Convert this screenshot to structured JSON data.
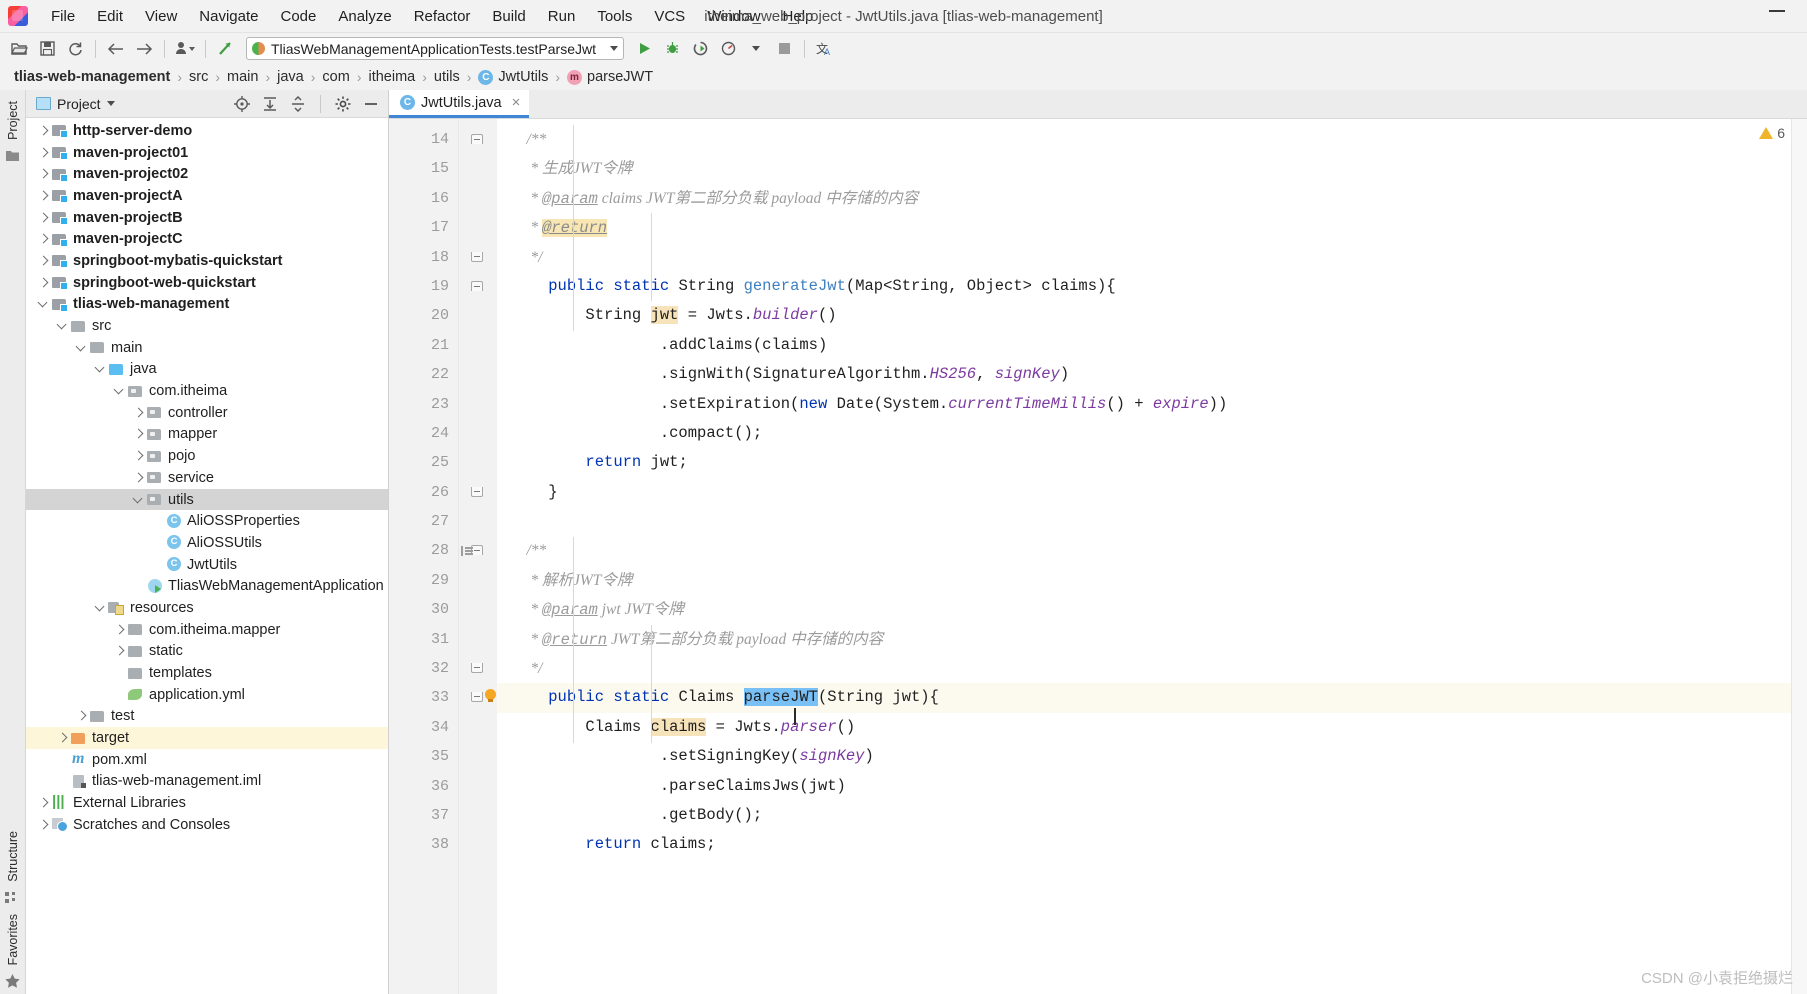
{
  "window": {
    "title": "itheima_web_project - JwtUtils.java [tlias-web-management]",
    "minimize_label": "—"
  },
  "menubar": {
    "items": [
      {
        "label": "File",
        "mnemonic": "F"
      },
      {
        "label": "Edit",
        "mnemonic": "E"
      },
      {
        "label": "View",
        "mnemonic": "V"
      },
      {
        "label": "Navigate",
        "mnemonic": "N"
      },
      {
        "label": "Code",
        "mnemonic": "C"
      },
      {
        "label": "Analyze",
        "mnemonic": "z"
      },
      {
        "label": "Refactor",
        "mnemonic": "R"
      },
      {
        "label": "Build",
        "mnemonic": "B"
      },
      {
        "label": "Run",
        "mnemonic": "u"
      },
      {
        "label": "Tools",
        "mnemonic": "T"
      },
      {
        "label": "VCS",
        "mnemonic": "S"
      },
      {
        "label": "Window",
        "mnemonic": "W"
      },
      {
        "label": "Help",
        "mnemonic": "H"
      }
    ]
  },
  "toolbar": {
    "run_config": "TliasWebManagementApplicationTests.testParseJwt",
    "buttons": [
      "open-project-icon",
      "save-all-icon",
      "sync-icon",
      "back-icon",
      "forward-icon",
      "profile-icon",
      "update-project-icon",
      "run-icon",
      "debug-icon",
      "run-coverage-icon",
      "profiler-icon",
      "stop-icon",
      "translate-icon"
    ]
  },
  "breadcrumb": {
    "items": [
      {
        "label": "tlias-web-management",
        "icon": "",
        "bold": true
      },
      {
        "label": "src",
        "icon": ""
      },
      {
        "label": "main",
        "icon": ""
      },
      {
        "label": "java",
        "icon": ""
      },
      {
        "label": "com",
        "icon": ""
      },
      {
        "label": "itheima",
        "icon": ""
      },
      {
        "label": "utils",
        "icon": ""
      },
      {
        "label": "JwtUtils",
        "icon": "class"
      },
      {
        "label": "parseJWT",
        "icon": "method"
      }
    ],
    "separator": "›"
  },
  "left_rail": {
    "top_label": "Project",
    "structure_label": "Structure",
    "favorites_label": "Favorites"
  },
  "project_panel": {
    "title": "Project",
    "header_buttons": [
      "locate-icon",
      "expand-all-icon",
      "collapse-all-icon",
      "gear-icon",
      "hide-icon"
    ],
    "tree": [
      {
        "label": "http-server-demo",
        "depth": 0,
        "arrow": "right",
        "icon": "folder-mod",
        "bold": true
      },
      {
        "label": "maven-project01",
        "depth": 0,
        "arrow": "right",
        "icon": "folder-mod",
        "bold": true
      },
      {
        "label": "maven-project02",
        "depth": 0,
        "arrow": "right",
        "icon": "folder-mod",
        "bold": true
      },
      {
        "label": "maven-projectA",
        "depth": 0,
        "arrow": "right",
        "icon": "folder-mod",
        "bold": true
      },
      {
        "label": "maven-projectB",
        "depth": 0,
        "arrow": "right",
        "icon": "folder-mod",
        "bold": true
      },
      {
        "label": "maven-projectC",
        "depth": 0,
        "arrow": "right",
        "icon": "folder-mod",
        "bold": true
      },
      {
        "label": "springboot-mybatis-quickstart",
        "depth": 0,
        "arrow": "right",
        "icon": "folder-mod",
        "bold": true
      },
      {
        "label": "springboot-web-quickstart",
        "depth": 0,
        "arrow": "right",
        "icon": "folder-mod",
        "bold": true
      },
      {
        "label": "tlias-web-management",
        "depth": 0,
        "arrow": "down",
        "icon": "folder-mod",
        "bold": true
      },
      {
        "label": "src",
        "depth": 1,
        "arrow": "down",
        "icon": "folder"
      },
      {
        "label": "main",
        "depth": 2,
        "arrow": "down",
        "icon": "folder"
      },
      {
        "label": "java",
        "depth": 3,
        "arrow": "down",
        "icon": "folder-src"
      },
      {
        "label": "com.itheima",
        "depth": 4,
        "arrow": "down",
        "icon": "folder-pkg"
      },
      {
        "label": "controller",
        "depth": 5,
        "arrow": "right",
        "icon": "folder-pkg"
      },
      {
        "label": "mapper",
        "depth": 5,
        "arrow": "right",
        "icon": "folder-pkg"
      },
      {
        "label": "pojo",
        "depth": 5,
        "arrow": "right",
        "icon": "folder-pkg"
      },
      {
        "label": "service",
        "depth": 5,
        "arrow": "right",
        "icon": "folder-pkg"
      },
      {
        "label": "utils",
        "depth": 5,
        "arrow": "down",
        "icon": "folder-pkg",
        "state": "selected"
      },
      {
        "label": "AliOSSProperties",
        "depth": 6,
        "arrow": "none",
        "icon": "javaclass"
      },
      {
        "label": "AliOSSUtils",
        "depth": 6,
        "arrow": "none",
        "icon": "javaclass"
      },
      {
        "label": "JwtUtils",
        "depth": 6,
        "arrow": "none",
        "icon": "javaclass"
      },
      {
        "label": "TliasWebManagementApplication",
        "depth": 5,
        "arrow": "none",
        "icon": "springboot"
      },
      {
        "label": "resources",
        "depth": 3,
        "arrow": "down",
        "icon": "folder-res"
      },
      {
        "label": "com.itheima.mapper",
        "depth": 4,
        "arrow": "right",
        "icon": "folder"
      },
      {
        "label": "static",
        "depth": 4,
        "arrow": "right",
        "icon": "folder"
      },
      {
        "label": "templates",
        "depth": 4,
        "arrow": "none",
        "icon": "folder"
      },
      {
        "label": "application.yml",
        "depth": 4,
        "arrow": "none",
        "icon": "yml"
      },
      {
        "label": "test",
        "depth": 2,
        "arrow": "right",
        "icon": "folder"
      },
      {
        "label": "target",
        "depth": 1,
        "arrow": "right",
        "icon": "folder-target",
        "state": "highlight"
      },
      {
        "label": "pom.xml",
        "depth": 1,
        "arrow": "none",
        "icon": "mvn"
      },
      {
        "label": "tlias-web-management.iml",
        "depth": 1,
        "arrow": "none",
        "icon": "iml"
      },
      {
        "label": "External Libraries",
        "depth": 0,
        "arrow": "right",
        "icon": "extlib"
      },
      {
        "label": "Scratches and Consoles",
        "depth": 0,
        "arrow": "right",
        "icon": "scratch"
      }
    ]
  },
  "editor": {
    "tab": {
      "label": "JwtUtils.java",
      "icon": "java-class-icon",
      "close": "×"
    },
    "warnings": {
      "count": "6",
      "icon": "warning-triangle-icon"
    },
    "first_line_number": 14,
    "lines": [
      {
        "n": 14,
        "fold": "top",
        "tokens": [
          {
            "t": "    /**",
            "c": "cmt"
          }
        ]
      },
      {
        "n": 15,
        "tokens": [
          {
            "t": "     * ",
            "c": "cmt"
          },
          {
            "t": "生成JWT令牌",
            "c": "cmt"
          }
        ]
      },
      {
        "n": 16,
        "tokens": [
          {
            "t": "     * ",
            "c": "cmt"
          },
          {
            "t": "@param",
            "c": "tag"
          },
          {
            "t": " claims ",
            "c": "cmt"
          },
          {
            "t": "JWT第二部分负载 payload 中存储的内容",
            "c": "cmt"
          }
        ]
      },
      {
        "n": 17,
        "tokens": [
          {
            "t": "     * ",
            "c": "cmt"
          },
          {
            "t": "@return",
            "c": "tag-hl"
          }
        ]
      },
      {
        "n": 18,
        "fold": "bottom",
        "tokens": [
          {
            "t": "     */",
            "c": "cmt"
          }
        ]
      },
      {
        "n": 19,
        "fold": "top",
        "tokens": [
          {
            "t": "    ",
            "c": "plain"
          },
          {
            "t": "public static",
            "c": "kw"
          },
          {
            "t": " String ",
            "c": "plain"
          },
          {
            "t": "generateJwt",
            "c": "mth"
          },
          {
            "t": "(Map<String, Object> claims){",
            "c": "plain"
          }
        ]
      },
      {
        "n": 20,
        "tokens": [
          {
            "t": "        String ",
            "c": "plain"
          },
          {
            "t": "jwt",
            "c": "ident-hl"
          },
          {
            "t": " = Jwts.",
            "c": "plain"
          },
          {
            "t": "builder",
            "c": "stat"
          },
          {
            "t": "()",
            "c": "plain"
          }
        ]
      },
      {
        "n": 21,
        "tokens": [
          {
            "t": "                .addClaims(claims)",
            "c": "plain"
          }
        ]
      },
      {
        "n": 22,
        "tokens": [
          {
            "t": "                .signWith(SignatureAlgorithm.",
            "c": "plain"
          },
          {
            "t": "HS256",
            "c": "stat"
          },
          {
            "t": ", ",
            "c": "plain"
          },
          {
            "t": "signKey",
            "c": "stat"
          },
          {
            "t": ")",
            "c": "plain"
          }
        ]
      },
      {
        "n": 23,
        "tokens": [
          {
            "t": "                .setExpiration(",
            "c": "plain"
          },
          {
            "t": "new",
            "c": "kw"
          },
          {
            "t": " Date(System.",
            "c": "plain"
          },
          {
            "t": "currentTimeMillis",
            "c": "stat"
          },
          {
            "t": "() + ",
            "c": "plain"
          },
          {
            "t": "expire",
            "c": "stat"
          },
          {
            "t": "))",
            "c": "plain"
          }
        ]
      },
      {
        "n": 24,
        "tokens": [
          {
            "t": "                .compact();",
            "c": "plain"
          }
        ]
      },
      {
        "n": 25,
        "tokens": [
          {
            "t": "        ",
            "c": "plain"
          },
          {
            "t": "return",
            "c": "kw"
          },
          {
            "t": " jwt;",
            "c": "plain"
          }
        ]
      },
      {
        "n": 26,
        "fold": "bottom",
        "tokens": [
          {
            "t": "    }",
            "c": "plain"
          }
        ]
      },
      {
        "n": 27,
        "tokens": [
          {
            "t": "",
            "c": "plain"
          }
        ]
      },
      {
        "n": 28,
        "fold": "top",
        "doc": true,
        "tokens": [
          {
            "t": "    /**",
            "c": "cmt"
          }
        ]
      },
      {
        "n": 29,
        "tokens": [
          {
            "t": "     * ",
            "c": "cmt"
          },
          {
            "t": "解析JWT令牌",
            "c": "cmt"
          }
        ]
      },
      {
        "n": 30,
        "tokens": [
          {
            "t": "     * ",
            "c": "cmt"
          },
          {
            "t": "@param",
            "c": "tag"
          },
          {
            "t": " jwt ",
            "c": "cmt"
          },
          {
            "t": "JWT令牌",
            "c": "cmt"
          }
        ]
      },
      {
        "n": 31,
        "tokens": [
          {
            "t": "     * ",
            "c": "cmt"
          },
          {
            "t": "@return",
            "c": "tag"
          },
          {
            "t": " JWT第二部分负载 payload 中存储的内容",
            "c": "cmt"
          }
        ]
      },
      {
        "n": 32,
        "fold": "bottom",
        "tokens": [
          {
            "t": "     */",
            "c": "cmt"
          }
        ]
      },
      {
        "n": 33,
        "fold": "bottom",
        "bulb": true,
        "current": true,
        "tokens": [
          {
            "t": "    ",
            "c": "plain"
          },
          {
            "t": "public static",
            "c": "kw"
          },
          {
            "t": " Claims ",
            "c": "plain"
          },
          {
            "t": "parseJWT",
            "c": "sel-hl"
          },
          {
            "t": "(String jwt){",
            "c": "plain"
          }
        ]
      },
      {
        "n": 34,
        "tokens": [
          {
            "t": "        Claims ",
            "c": "plain"
          },
          {
            "t": "claims",
            "c": "ident-hl"
          },
          {
            "t": " = Jwts.",
            "c": "plain"
          },
          {
            "t": "parser",
            "c": "stat"
          },
          {
            "t": "()",
            "c": "plain"
          }
        ]
      },
      {
        "n": 35,
        "tokens": [
          {
            "t": "                .setSigningKey(",
            "c": "plain"
          },
          {
            "t": "signKey",
            "c": "stat"
          },
          {
            "t": ")",
            "c": "plain"
          }
        ]
      },
      {
        "n": 36,
        "tokens": [
          {
            "t": "                .parseClaimsJws(jwt)",
            "c": "plain"
          }
        ]
      },
      {
        "n": 37,
        "tokens": [
          {
            "t": "                .getBody();",
            "c": "plain"
          }
        ]
      },
      {
        "n": 38,
        "tokens": [
          {
            "t": "        ",
            "c": "plain"
          },
          {
            "t": "return",
            "c": "kw"
          },
          {
            "t": " claims;",
            "c": "plain"
          }
        ]
      }
    ]
  },
  "watermark": "CSDN @小袁拒绝摄烂"
}
